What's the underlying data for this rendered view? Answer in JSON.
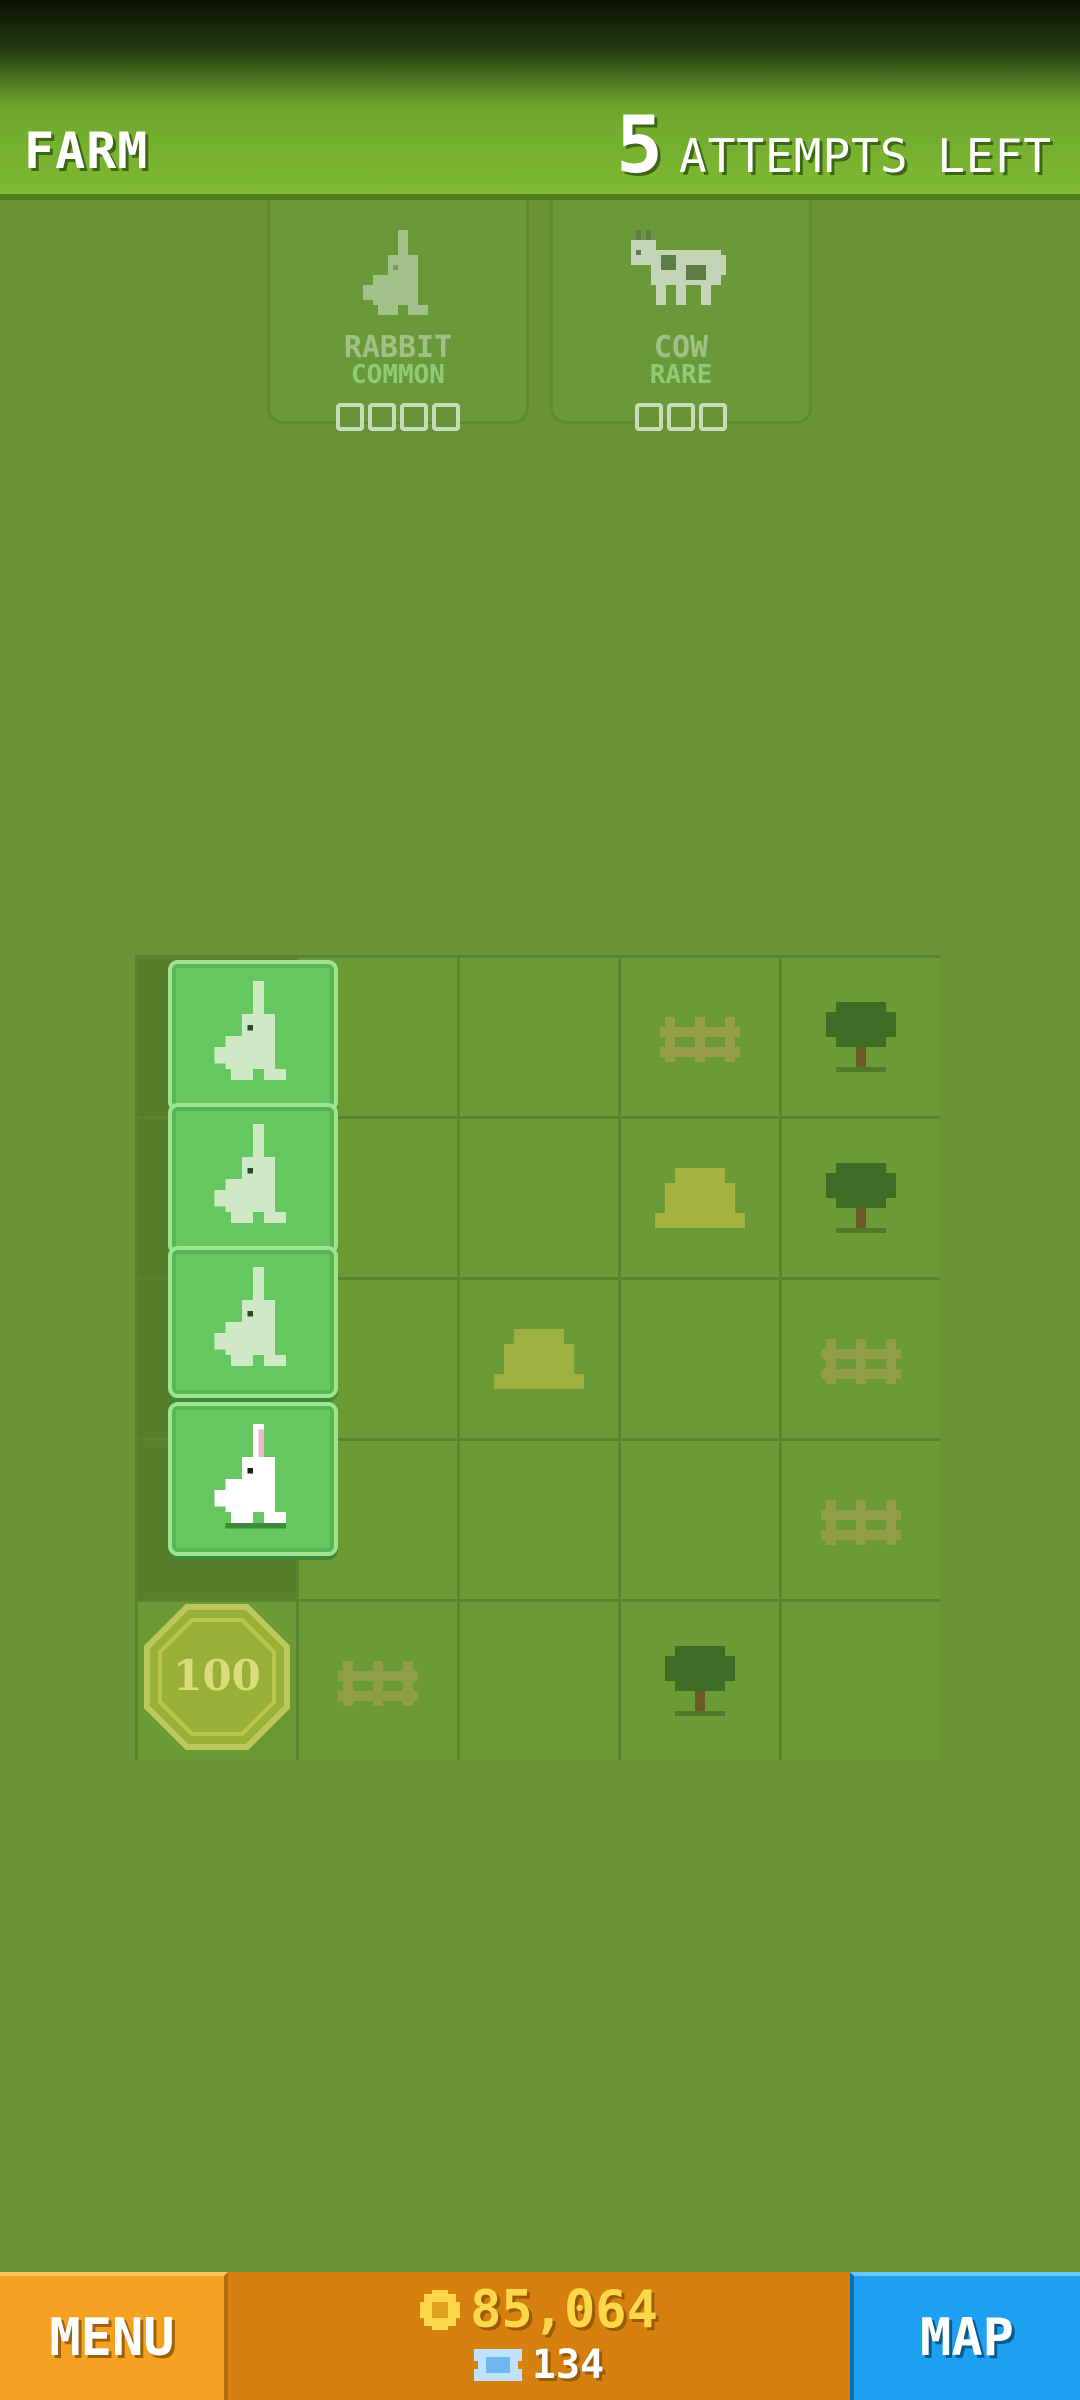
{
  "header": {
    "area_name": "FARM",
    "attempts_count": "5",
    "attempts_label": "ATTEMPTS LEFT"
  },
  "animals": [
    {
      "name": "RABBIT",
      "rarity": "COMMON",
      "slots": 4,
      "icon": "rabbit-icon"
    },
    {
      "name": "COW",
      "rarity": "RARE",
      "slots": 3,
      "icon": "cow-icon"
    }
  ],
  "board": {
    "bonus_coin_value": "100",
    "grid_icons": [
      "fence-icon",
      "tree-icon",
      "hay-icon",
      "rock-icon"
    ]
  },
  "bottom": {
    "menu_label": "MENU",
    "map_label": "MAP",
    "coins": "85,064",
    "tickets": "134"
  },
  "colors": {
    "background": "#6a9236",
    "menu_button": "#f4a020",
    "map_button": "#1ea0f0",
    "coins_text": "#ffd84a"
  }
}
